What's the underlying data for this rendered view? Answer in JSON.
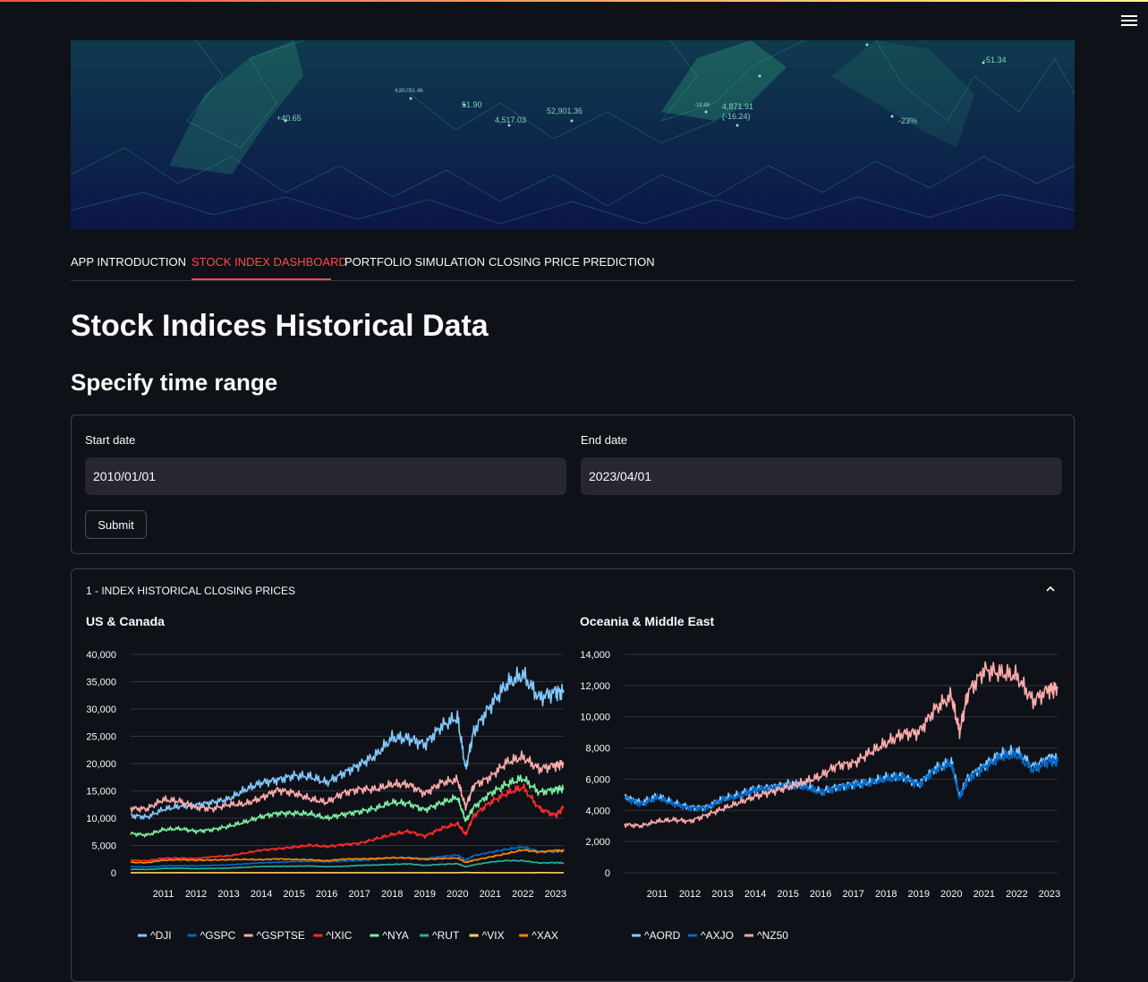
{
  "tabs": [
    "APP INTRODUCTION",
    "STOCK INDEX DASHBOARD",
    "PORTFOLIO SIMULATION",
    "CLOSING PRICE PREDICTION"
  ],
  "active_tab": 1,
  "banner": {
    "numbers": [
      "+40.65",
      "51.90",
      "4,517.03",
      "52,901.36",
      "4,871.91",
      "(-16.24)",
      "-23%",
      "-51.34",
      "-18.68",
      "4,80,051.46"
    ]
  },
  "page_title": "Stock Indices Historical Data",
  "section_title": "Specify time range",
  "form": {
    "start_label": "Start date",
    "start_value": "2010/01/01",
    "end_label": "End date",
    "end_value": "2023/04/01",
    "submit_label": "Submit"
  },
  "expander": {
    "label": "1 - INDEX HISTORICAL CLOSING PRICES"
  },
  "chart_data": [
    {
      "type": "line",
      "title": "US & Canada",
      "xlabel": "",
      "ylabel": "",
      "x": [
        2010.0,
        2010.5,
        2011.0,
        2011.5,
        2012.0,
        2012.5,
        2013.0,
        2013.5,
        2014.0,
        2014.5,
        2015.0,
        2015.5,
        2016.0,
        2016.5,
        2017.0,
        2017.5,
        2018.0,
        2018.5,
        2019.0,
        2019.5,
        2020.0,
        2020.25,
        2020.5,
        2021.0,
        2021.5,
        2022.0,
        2022.5,
        2023.0,
        2023.25
      ],
      "xticks": [
        2011,
        2012,
        2013,
        2014,
        2015,
        2016,
        2017,
        2018,
        2019,
        2020,
        2021,
        2022,
        2023
      ],
      "yticks": [
        0,
        5000,
        10000,
        15000,
        20000,
        25000,
        30000,
        35000,
        40000
      ],
      "ylim": [
        0,
        40000
      ],
      "xlim": [
        2010.0,
        2023.25
      ],
      "legend_position": "bottom",
      "grid": true,
      "series": [
        {
          "name": "^DJI",
          "color": "#83c9ff",
          "values": [
            10500,
            10200,
            11600,
            12200,
            12400,
            12900,
            13500,
            15200,
            16500,
            17000,
            17800,
            17600,
            16500,
            18200,
            19800,
            21500,
            24700,
            24600,
            23500,
            26800,
            28500,
            19000,
            26000,
            30500,
            34500,
            36300,
            32000,
            33200,
            33000
          ]
        },
        {
          "name": "^GSPC",
          "color": "#0068c9",
          "values": [
            1130,
            1050,
            1270,
            1290,
            1280,
            1370,
            1450,
            1650,
            1830,
            1950,
            2060,
            2080,
            2000,
            2150,
            2250,
            2450,
            2750,
            2750,
            2600,
            2950,
            3250,
            2300,
            3150,
            3750,
            4300,
            4760,
            3900,
            3850,
            4100
          ]
        },
        {
          "name": "^GSPTSE",
          "color": "#ffabab",
          "values": [
            11800,
            11700,
            13400,
            13100,
            12000,
            11700,
            12500,
            12600,
            13700,
            15200,
            14600,
            13500,
            12900,
            14600,
            15300,
            15300,
            16200,
            16200,
            14500,
            16500,
            17000,
            12000,
            16000,
            17500,
            20200,
            21200,
            19000,
            19700,
            20000
          ]
        },
        {
          "name": "^IXIC",
          "color": "#ff2b2b",
          "values": [
            2300,
            2200,
            2650,
            2700,
            2600,
            2950,
            3100,
            3600,
            4150,
            4400,
            4700,
            5050,
            4800,
            5150,
            5400,
            6200,
            7000,
            7600,
            6700,
            8100,
            9000,
            7000,
            10500,
            12900,
            14500,
            15700,
            11800,
            10500,
            12000
          ]
        },
        {
          "name": "^NYA",
          "color": "#7defa1",
          "values": [
            7200,
            6900,
            7900,
            8100,
            7600,
            7900,
            8500,
            9300,
            10300,
            10900,
            10900,
            10800,
            10000,
            10700,
            11200,
            11800,
            12900,
            12700,
            11500,
            12800,
            13800,
            9500,
            12000,
            14500,
            16200,
            17300,
            14700,
            15300,
            15500
          ]
        },
        {
          "name": "^RUT",
          "color": "#29b09d",
          "values": [
            630,
            610,
            800,
            830,
            750,
            790,
            870,
            1000,
            1160,
            1180,
            1200,
            1240,
            1120,
            1180,
            1360,
            1420,
            1540,
            1640,
            1350,
            1550,
            1670,
            1100,
            1450,
            1950,
            2250,
            2200,
            1800,
            1860,
            1800
          ]
        },
        {
          "name": "^VIX",
          "color": "#ffd16a",
          "values": [
            20,
            25,
            18,
            25,
            23,
            17,
            14,
            13,
            14,
            12,
            17,
            15,
            22,
            14,
            11,
            10,
            13,
            13,
            25,
            15,
            14,
            60,
            25,
            22,
            18,
            17,
            28,
            21,
            19
          ]
        },
        {
          "name": "^XAX",
          "color": "#ff8700",
          "values": [
            1900,
            1850,
            2300,
            2400,
            2300,
            2350,
            2400,
            2450,
            2400,
            2550,
            2450,
            2380,
            2200,
            2500,
            2550,
            2600,
            2750,
            2700,
            2450,
            2600,
            2700,
            1900,
            2300,
            2900,
            3500,
            4200,
            3800,
            4100,
            4000
          ]
        }
      ]
    },
    {
      "type": "line",
      "title": "Oceania & Middle East",
      "xlabel": "",
      "ylabel": "",
      "x": [
        2010.0,
        2010.5,
        2011.0,
        2011.5,
        2012.0,
        2012.5,
        2013.0,
        2013.5,
        2014.0,
        2014.5,
        2015.0,
        2015.5,
        2016.0,
        2016.5,
        2017.0,
        2017.5,
        2018.0,
        2018.5,
        2019.0,
        2019.5,
        2020.0,
        2020.25,
        2020.5,
        2021.0,
        2021.5,
        2022.0,
        2022.5,
        2023.0,
        2023.25
      ],
      "xticks": [
        2011,
        2012,
        2013,
        2014,
        2015,
        2016,
        2017,
        2018,
        2019,
        2020,
        2021,
        2022,
        2023
      ],
      "yticks": [
        0,
        2000,
        4000,
        6000,
        8000,
        10000,
        12000,
        14000
      ],
      "ylim": [
        0,
        14000
      ],
      "xlim": [
        2010.0,
        2023.25
      ],
      "legend_position": "bottom",
      "grid": true,
      "series": [
        {
          "name": "^AORD",
          "color": "#83c9ff",
          "values": [
            4900,
            4500,
            4900,
            4500,
            4200,
            4200,
            4750,
            5000,
            5400,
            5500,
            5700,
            5600,
            5200,
            5500,
            5700,
            5800,
            6100,
            6200,
            5700,
            6700,
            7100,
            4900,
            6100,
            6900,
            7600,
            7800,
            6800,
            7400,
            7300
          ]
        },
        {
          "name": "^AXJO",
          "color": "#0068c9",
          "values": [
            4800,
            4400,
            4800,
            4400,
            4150,
            4150,
            4700,
            4900,
            5300,
            5450,
            5600,
            5500,
            5150,
            5450,
            5650,
            5750,
            6000,
            6150,
            5650,
            6600,
            7000,
            4800,
            6000,
            6750,
            7400,
            7550,
            6600,
            7200,
            7100
          ]
        },
        {
          "name": "^NZ50",
          "color": "#ffabab",
          "values": [
            3100,
            3000,
            3300,
            3400,
            3300,
            3700,
            4100,
            4500,
            4900,
            5200,
            5500,
            5800,
            6200,
            6900,
            7000,
            7700,
            8300,
            8900,
            9000,
            10500,
            11300,
            9000,
            11500,
            13000,
            12800,
            12600,
            11000,
            11800,
            11800
          ]
        }
      ]
    }
  ]
}
